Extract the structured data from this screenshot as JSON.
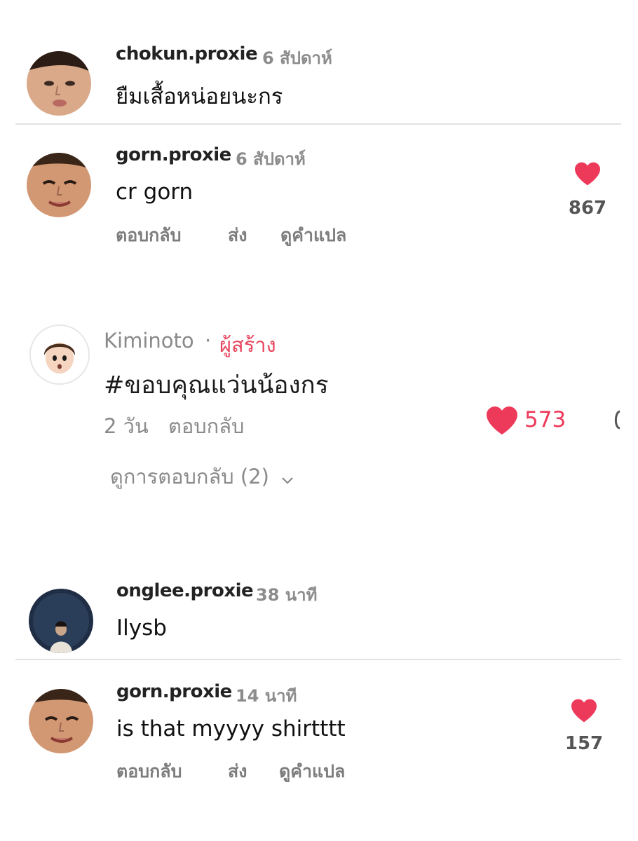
{
  "comments": [
    {
      "username": "chokun.proxie",
      "time": "6 สัปดาห์",
      "text": "ยืมเสื้อหน่อยนะกร"
    },
    {
      "username": "gorn.proxie",
      "time": "6 สัปดาห์",
      "text": "cr gorn",
      "likes": "867",
      "actions": [
        "ตอบกลับ",
        "ส่ง",
        "ดูคำแปล"
      ]
    },
    {
      "username": "onglee.proxie",
      "time": "38 นาที",
      "text": "Ilysb"
    },
    {
      "username": "gorn.proxie",
      "time": "14 นาที",
      "text": "is that myyyy shirtttt",
      "likes": "157",
      "actions": [
        "ตอบกลับ",
        "ส่ง",
        "ดูคำแปล"
      ]
    }
  ],
  "tiktok_comment": {
    "username": "Kiminoto",
    "separator": "·",
    "creator_label": "ผู้สร้าง",
    "text": "#ขอบคุณแว่นน้องกร",
    "time": "2 วัน",
    "reply_label": "ตอบกลับ",
    "likes": "573",
    "view_replies": "ดูการตอบกลับ (2)"
  },
  "colors": {
    "like_red": "#ee3a5a",
    "creator_pink": "#e8455e",
    "muted_gray": "#8a8a8a"
  }
}
